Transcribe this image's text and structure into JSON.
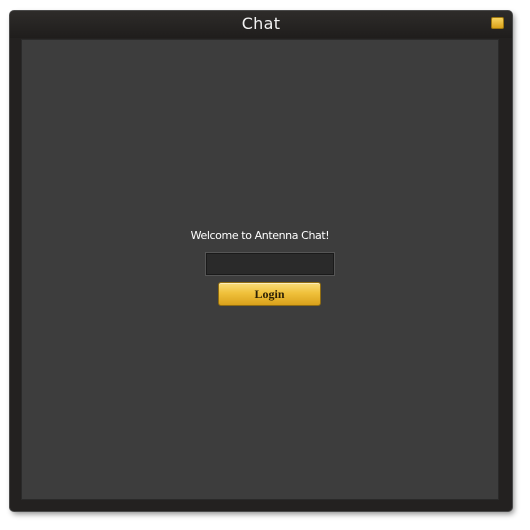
{
  "window": {
    "title": "Chat",
    "minimize_icon": "minimize-icon"
  },
  "login": {
    "welcome_text": "Welcome to Antenna Chat!",
    "name_value": "",
    "name_placeholder": "",
    "button_label": "Login"
  },
  "colors": {
    "accent": "#f0c13b",
    "panel_bg": "#3d3d3d",
    "frame_bg": "#232120"
  }
}
